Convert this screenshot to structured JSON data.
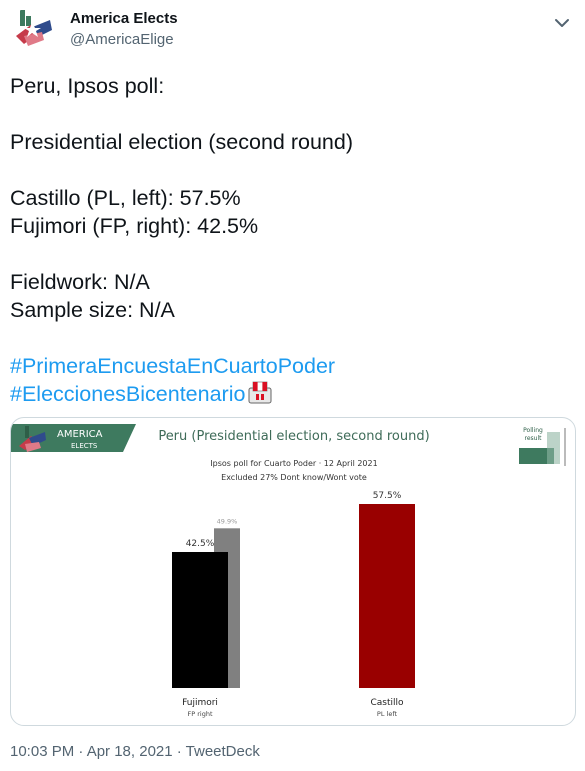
{
  "account": {
    "name": "America Elects",
    "handle": "@AmericaElige"
  },
  "tweet": {
    "line1": "Peru, Ipsos poll:",
    "line2": "Presidential election (second round)",
    "line3": "Castillo (PL, left): 57.5%",
    "line4": "Fujimori (FP, right): 42.5%",
    "line5": "Fieldwork: N/A",
    "line6": "Sample size: N/A",
    "hashtag1": "#PrimeraEncuestaEnCuartoPoder",
    "hashtag2": "#EleccionesBicentenario",
    "ballot_icon": "ballot-box-peru-flag-icon"
  },
  "card": {
    "logo_line1": "AMERICA",
    "logo_line2": "ELECTS",
    "polling_label_1": "Polling",
    "polling_label_2": "result"
  },
  "chart_data": {
    "type": "bar",
    "title": "Peru (Presidential election, second round)",
    "subtitle1": "Ipsos poll for Cuarto Poder · 12 April 2021",
    "subtitle2": "Excluded 27% Dont know/Wont vote",
    "categories": [
      "Fujimori",
      "Castillo"
    ],
    "category_sub": [
      "FP right",
      "PL left"
    ],
    "series": [
      {
        "name": "current",
        "values": [
          42.5,
          57.5
        ],
        "colors": [
          "#000000",
          "#990000"
        ]
      },
      {
        "name": "previous",
        "values": [
          49.9,
          null
        ],
        "colors": [
          "#808080",
          null
        ]
      }
    ],
    "value_labels": [
      "42.5%",
      "57.5%"
    ],
    "prev_labels": [
      "49.9%",
      ""
    ],
    "ylim": [
      0,
      70
    ],
    "grid": false
  },
  "timestamp": "10:03 PM · Apr 18, 2021 · TweetDeck",
  "colors": {
    "brand_green": "#3e7a5f",
    "hashtag": "#1d9bf0",
    "castillo": "#990000",
    "fujimori": "#000000",
    "previous": "#808080"
  }
}
